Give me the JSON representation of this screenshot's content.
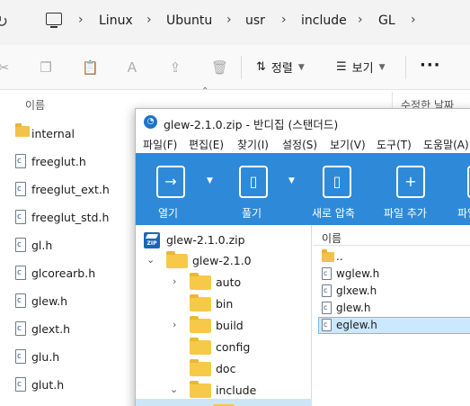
{
  "explorer": {
    "breadcrumb": [
      "Linux",
      "Ubuntu",
      "usr",
      "include",
      "GL"
    ],
    "toolbar": {
      "sort_label": "정렬",
      "view_label": "보기"
    },
    "column_name": "이름",
    "column_date": "수정한 날짜",
    "files": [
      {
        "name": "internal",
        "type": "folder"
      },
      {
        "name": "freeglut.h",
        "type": "file"
      },
      {
        "name": "freeglut_ext.h",
        "type": "file"
      },
      {
        "name": "freeglut_std.h",
        "type": "file"
      },
      {
        "name": "gl.h",
        "type": "file"
      },
      {
        "name": "glcorearb.h",
        "type": "file"
      },
      {
        "name": "glew.h",
        "type": "file"
      },
      {
        "name": "glext.h",
        "type": "file"
      },
      {
        "name": "glu.h",
        "type": "file"
      },
      {
        "name": "glut.h",
        "type": "file"
      }
    ]
  },
  "bandizip": {
    "title": "glew-2.1.0.zip - 반디집 (스탠더드)",
    "menu": [
      "파일(F)",
      "편집(E)",
      "찾기(I)",
      "설정(S)",
      "보기(V)",
      "도구(T)",
      "도움말(A)"
    ],
    "ribbon": [
      {
        "label": "열기",
        "icon": "open-icon"
      },
      {
        "label": "풀기",
        "icon": "extract-icon"
      },
      {
        "label": "새로 압축",
        "icon": "new-archive-icon"
      },
      {
        "label": "파일 추가",
        "icon": "add-file-icon"
      },
      {
        "label": "파일",
        "icon": "file-icon"
      }
    ],
    "tree": {
      "archive": "glew-2.1.0.zip",
      "root": "glew-2.1.0",
      "children": [
        "auto",
        "bin",
        "build",
        "config",
        "doc",
        "include"
      ]
    },
    "list_header": "이름",
    "list_items": [
      {
        "name": "..",
        "type": "folder"
      },
      {
        "name": "wglew.h",
        "type": "file"
      },
      {
        "name": "glxew.h",
        "type": "file"
      },
      {
        "name": "glew.h",
        "type": "file"
      },
      {
        "name": "eglew.h",
        "type": "file",
        "selected": true
      }
    ]
  }
}
